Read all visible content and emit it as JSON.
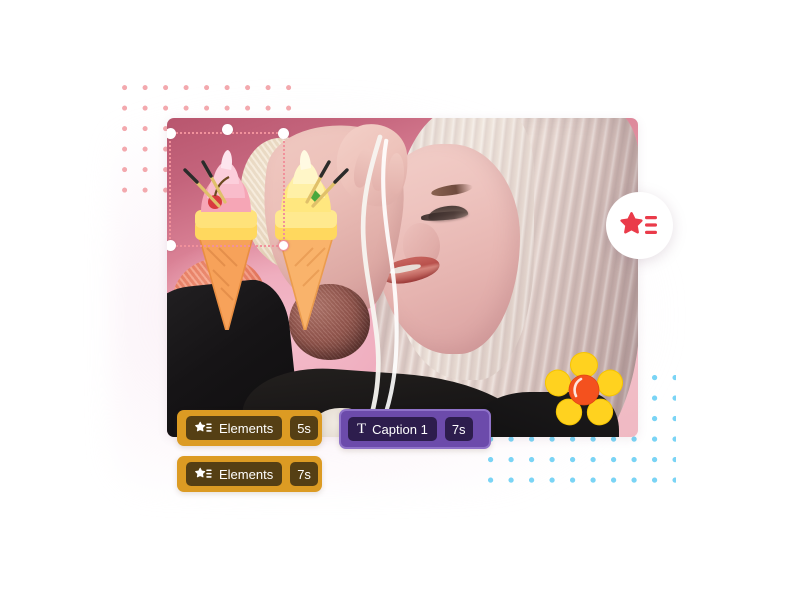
{
  "app": {
    "scene_title": "Video editor preview"
  },
  "canvas": {
    "photo": {
      "name": "portrait-photo",
      "description": "Blonde woman in black sweater against pink backdrop"
    },
    "selection": {
      "label": "sticker-selection-frame",
      "handles": [
        "top-left",
        "top-middle",
        "top-right",
        "bottom-left",
        "bottom-right"
      ]
    },
    "stickers": [
      {
        "name": "ice-cream-sticker",
        "icon": "ice-cream-cone"
      },
      {
        "name": "flower-sticker",
        "icon": "flower",
        "petal_color": "#FFD21F",
        "center_color": "#F4511E"
      }
    ],
    "badge": {
      "name": "elements-badge",
      "icon": "star-list-icon",
      "color": "#EA3B4A"
    },
    "decor": {
      "pink_dots_color": "#F3A9AE",
      "blue_dots_color": "#7AD4F5"
    }
  },
  "timeline": {
    "clips": [
      {
        "id": "clip-elements-1",
        "type": "elements",
        "icon": "star-list-icon",
        "label": "Elements",
        "duration": "5s",
        "bar_color": "#DC9B23",
        "pill_color": "#553F14"
      },
      {
        "id": "clip-elements-2",
        "type": "elements",
        "icon": "star-list-icon",
        "label": "Elements",
        "duration": "7s",
        "bar_color": "#DC9B23",
        "pill_color": "#553F14"
      },
      {
        "id": "clip-caption-1",
        "type": "caption",
        "icon": "text-t-icon",
        "label": "Caption 1",
        "duration": "7s",
        "bar_color": "#6C4BAB",
        "pill_color": "#2D1D4D"
      }
    ]
  }
}
